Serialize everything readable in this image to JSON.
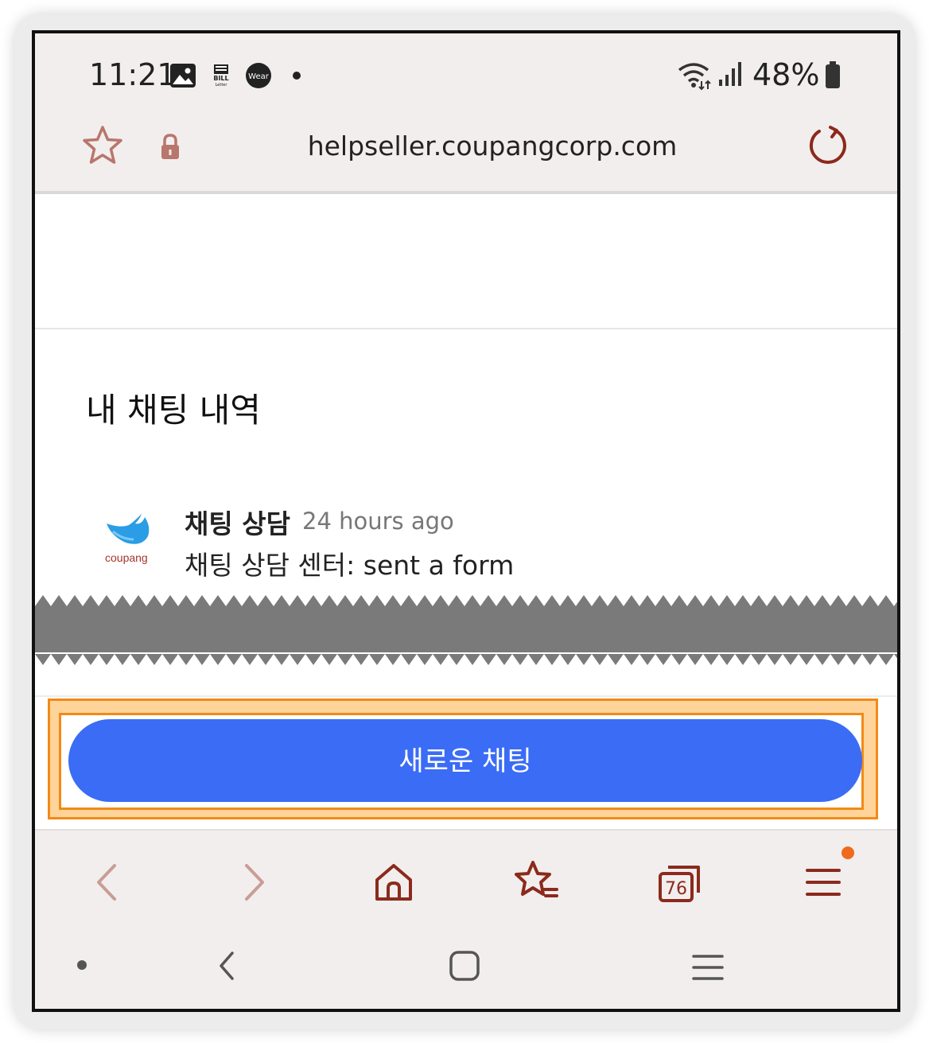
{
  "status_bar": {
    "time": "11:21",
    "battery_percent": "48%",
    "notification_icons": [
      "gallery-icon",
      "bill-letter-icon",
      "wear-icon"
    ],
    "bill_icon_text": "BILL",
    "bill_icon_subtext": "Letter",
    "wear_icon_text": "Wear"
  },
  "browser": {
    "url": "helpseller.coupangcorp.com",
    "tab_count": "76",
    "accent_color": "#8b2a1c"
  },
  "page": {
    "history_title": "내 채팅 내역",
    "chat": {
      "name": "채팅 상담",
      "time": "24 hours ago",
      "message": "채팅 상담 센터: sent a form",
      "logo_text": "coupang"
    },
    "new_chat_label": "새로운 채팅",
    "button_color": "#3b6cf6"
  }
}
